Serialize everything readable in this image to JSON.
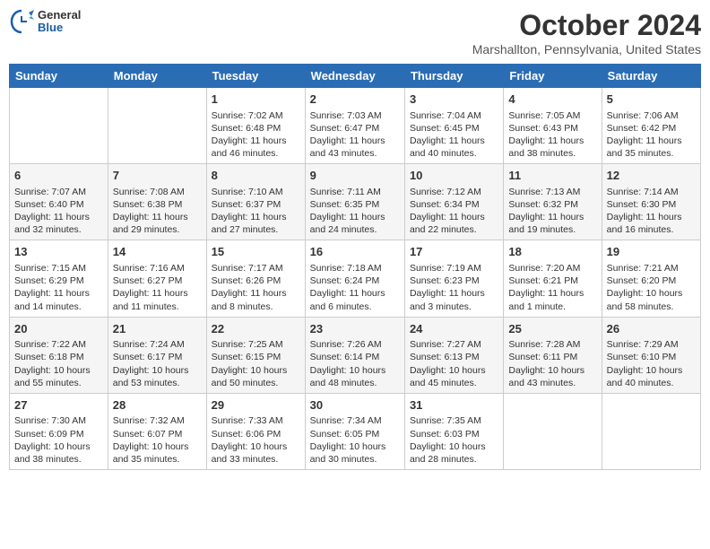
{
  "logo": {
    "general": "General",
    "blue": "Blue"
  },
  "title": "October 2024",
  "location": "Marshallton, Pennsylvania, United States",
  "headers": [
    "Sunday",
    "Monday",
    "Tuesday",
    "Wednesday",
    "Thursday",
    "Friday",
    "Saturday"
  ],
  "weeks": [
    [
      {
        "day": "",
        "content": ""
      },
      {
        "day": "",
        "content": ""
      },
      {
        "day": "1",
        "content": "Sunrise: 7:02 AM\nSunset: 6:48 PM\nDaylight: 11 hours and 46 minutes."
      },
      {
        "day": "2",
        "content": "Sunrise: 7:03 AM\nSunset: 6:47 PM\nDaylight: 11 hours and 43 minutes."
      },
      {
        "day": "3",
        "content": "Sunrise: 7:04 AM\nSunset: 6:45 PM\nDaylight: 11 hours and 40 minutes."
      },
      {
        "day": "4",
        "content": "Sunrise: 7:05 AM\nSunset: 6:43 PM\nDaylight: 11 hours and 38 minutes."
      },
      {
        "day": "5",
        "content": "Sunrise: 7:06 AM\nSunset: 6:42 PM\nDaylight: 11 hours and 35 minutes."
      }
    ],
    [
      {
        "day": "6",
        "content": "Sunrise: 7:07 AM\nSunset: 6:40 PM\nDaylight: 11 hours and 32 minutes."
      },
      {
        "day": "7",
        "content": "Sunrise: 7:08 AM\nSunset: 6:38 PM\nDaylight: 11 hours and 29 minutes."
      },
      {
        "day": "8",
        "content": "Sunrise: 7:10 AM\nSunset: 6:37 PM\nDaylight: 11 hours and 27 minutes."
      },
      {
        "day": "9",
        "content": "Sunrise: 7:11 AM\nSunset: 6:35 PM\nDaylight: 11 hours and 24 minutes."
      },
      {
        "day": "10",
        "content": "Sunrise: 7:12 AM\nSunset: 6:34 PM\nDaylight: 11 hours and 22 minutes."
      },
      {
        "day": "11",
        "content": "Sunrise: 7:13 AM\nSunset: 6:32 PM\nDaylight: 11 hours and 19 minutes."
      },
      {
        "day": "12",
        "content": "Sunrise: 7:14 AM\nSunset: 6:30 PM\nDaylight: 11 hours and 16 minutes."
      }
    ],
    [
      {
        "day": "13",
        "content": "Sunrise: 7:15 AM\nSunset: 6:29 PM\nDaylight: 11 hours and 14 minutes."
      },
      {
        "day": "14",
        "content": "Sunrise: 7:16 AM\nSunset: 6:27 PM\nDaylight: 11 hours and 11 minutes."
      },
      {
        "day": "15",
        "content": "Sunrise: 7:17 AM\nSunset: 6:26 PM\nDaylight: 11 hours and 8 minutes."
      },
      {
        "day": "16",
        "content": "Sunrise: 7:18 AM\nSunset: 6:24 PM\nDaylight: 11 hours and 6 minutes."
      },
      {
        "day": "17",
        "content": "Sunrise: 7:19 AM\nSunset: 6:23 PM\nDaylight: 11 hours and 3 minutes."
      },
      {
        "day": "18",
        "content": "Sunrise: 7:20 AM\nSunset: 6:21 PM\nDaylight: 11 hours and 1 minute."
      },
      {
        "day": "19",
        "content": "Sunrise: 7:21 AM\nSunset: 6:20 PM\nDaylight: 10 hours and 58 minutes."
      }
    ],
    [
      {
        "day": "20",
        "content": "Sunrise: 7:22 AM\nSunset: 6:18 PM\nDaylight: 10 hours and 55 minutes."
      },
      {
        "day": "21",
        "content": "Sunrise: 7:24 AM\nSunset: 6:17 PM\nDaylight: 10 hours and 53 minutes."
      },
      {
        "day": "22",
        "content": "Sunrise: 7:25 AM\nSunset: 6:15 PM\nDaylight: 10 hours and 50 minutes."
      },
      {
        "day": "23",
        "content": "Sunrise: 7:26 AM\nSunset: 6:14 PM\nDaylight: 10 hours and 48 minutes."
      },
      {
        "day": "24",
        "content": "Sunrise: 7:27 AM\nSunset: 6:13 PM\nDaylight: 10 hours and 45 minutes."
      },
      {
        "day": "25",
        "content": "Sunrise: 7:28 AM\nSunset: 6:11 PM\nDaylight: 10 hours and 43 minutes."
      },
      {
        "day": "26",
        "content": "Sunrise: 7:29 AM\nSunset: 6:10 PM\nDaylight: 10 hours and 40 minutes."
      }
    ],
    [
      {
        "day": "27",
        "content": "Sunrise: 7:30 AM\nSunset: 6:09 PM\nDaylight: 10 hours and 38 minutes."
      },
      {
        "day": "28",
        "content": "Sunrise: 7:32 AM\nSunset: 6:07 PM\nDaylight: 10 hours and 35 minutes."
      },
      {
        "day": "29",
        "content": "Sunrise: 7:33 AM\nSunset: 6:06 PM\nDaylight: 10 hours and 33 minutes."
      },
      {
        "day": "30",
        "content": "Sunrise: 7:34 AM\nSunset: 6:05 PM\nDaylight: 10 hours and 30 minutes."
      },
      {
        "day": "31",
        "content": "Sunrise: 7:35 AM\nSunset: 6:03 PM\nDaylight: 10 hours and 28 minutes."
      },
      {
        "day": "",
        "content": ""
      },
      {
        "day": "",
        "content": ""
      }
    ]
  ]
}
